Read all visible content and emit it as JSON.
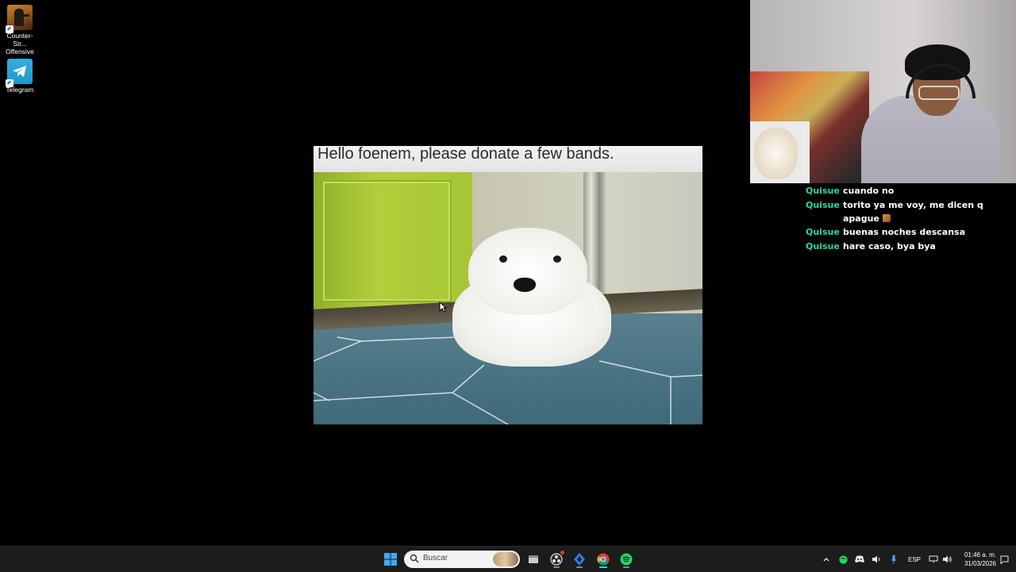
{
  "desktop": {
    "icons": [
      {
        "label_line1": "Counter-Str...",
        "label_line2": "Offensive",
        "icon": "counter-strike-icon"
      },
      {
        "label_line1": "Telegram",
        "icon": "telegram-icon"
      }
    ]
  },
  "meme": {
    "caption": "Hello foenem, please donate a few bands."
  },
  "chat": {
    "messages": [
      {
        "user": "Quisue",
        "text": "cuando no"
      },
      {
        "user": "Quisue",
        "text": "torito ya me voy, me dicen q apague"
      },
      {
        "user": "Quisue",
        "text": "buenas noches descansa"
      },
      {
        "user": "Quisue",
        "text": "hare caso, bya bya"
      }
    ],
    "username_color": "#2dd6a4"
  },
  "taskbar": {
    "search_placeholder": "Buscar",
    "language": "ESP",
    "time": "01:46 a. m.",
    "date": "31/03/2026",
    "accent": "#4cc2ff"
  }
}
